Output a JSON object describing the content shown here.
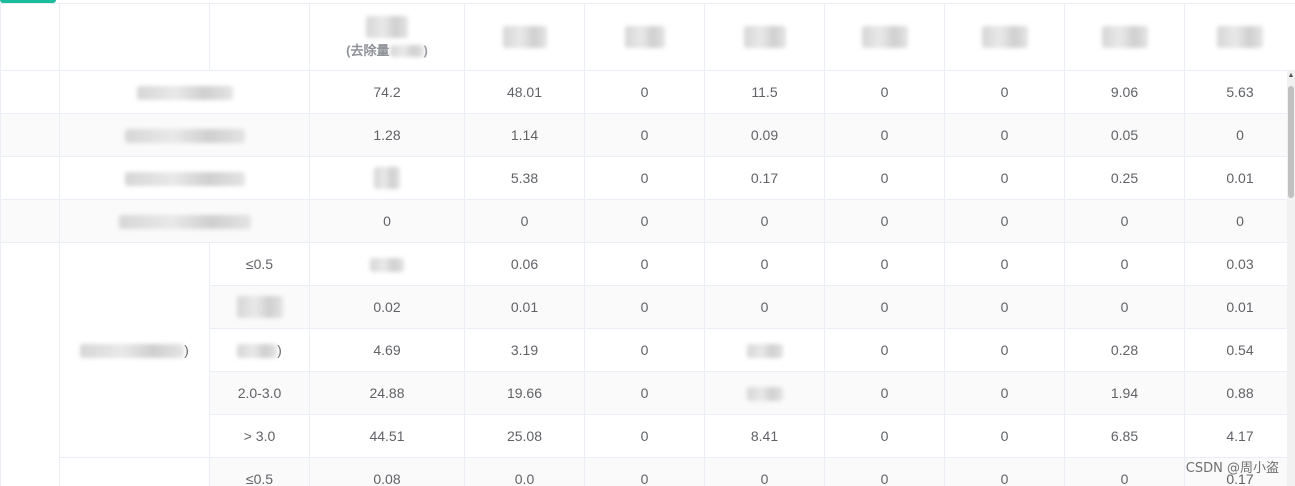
{
  "header": {
    "col4_line2": "(去除量",
    "col4_close": ")"
  },
  "rows": [
    {
      "cells": [
        "74.2",
        "48.01",
        "0",
        "11.5",
        "0",
        "0",
        "9.06",
        "5.63"
      ]
    },
    {
      "cells": [
        "1.28",
        "1.14",
        "0",
        "0.09",
        "0",
        "0",
        "0.05",
        "0"
      ]
    },
    {
      "cells": [
        "",
        "5.38",
        "0",
        "0.17",
        "0",
        "0",
        "0.25",
        "0.01"
      ]
    },
    {
      "cells": [
        "0",
        "0",
        "0",
        "0",
        "0",
        "0",
        "0",
        "0"
      ]
    }
  ],
  "group_rows": [
    {
      "sub": "≤0.5",
      "cells": [
        "",
        "0.06",
        "0",
        "0",
        "0",
        "0",
        "0",
        "0.03"
      ]
    },
    {
      "sub": "",
      "cells": [
        "0.02",
        "0.01",
        "0",
        "0",
        "0",
        "0",
        "0",
        "0.01"
      ]
    },
    {
      "sub": "",
      "sub_partial": ")",
      "cells": [
        "4.69",
        "3.19",
        "0",
        "",
        "0",
        "0",
        "0.28",
        "0.54"
      ]
    },
    {
      "sub": "2.0-3.0",
      "cells": [
        "24.88",
        "19.66",
        "0",
        "",
        "0",
        "0",
        "1.94",
        "0.88"
      ]
    },
    {
      "sub": "> 3.0",
      "cells": [
        "44.51",
        "25.08",
        "0",
        "8.41",
        "0",
        "0",
        "6.85",
        "4.17"
      ]
    },
    {
      "sub": "≤0.5",
      "cells": [
        "0.08",
        "0.0",
        "0",
        "0",
        "0",
        "0",
        "0",
        "0.17"
      ]
    }
  ],
  "group_label_partial": ")",
  "watermark": "CSDN @周小盗"
}
